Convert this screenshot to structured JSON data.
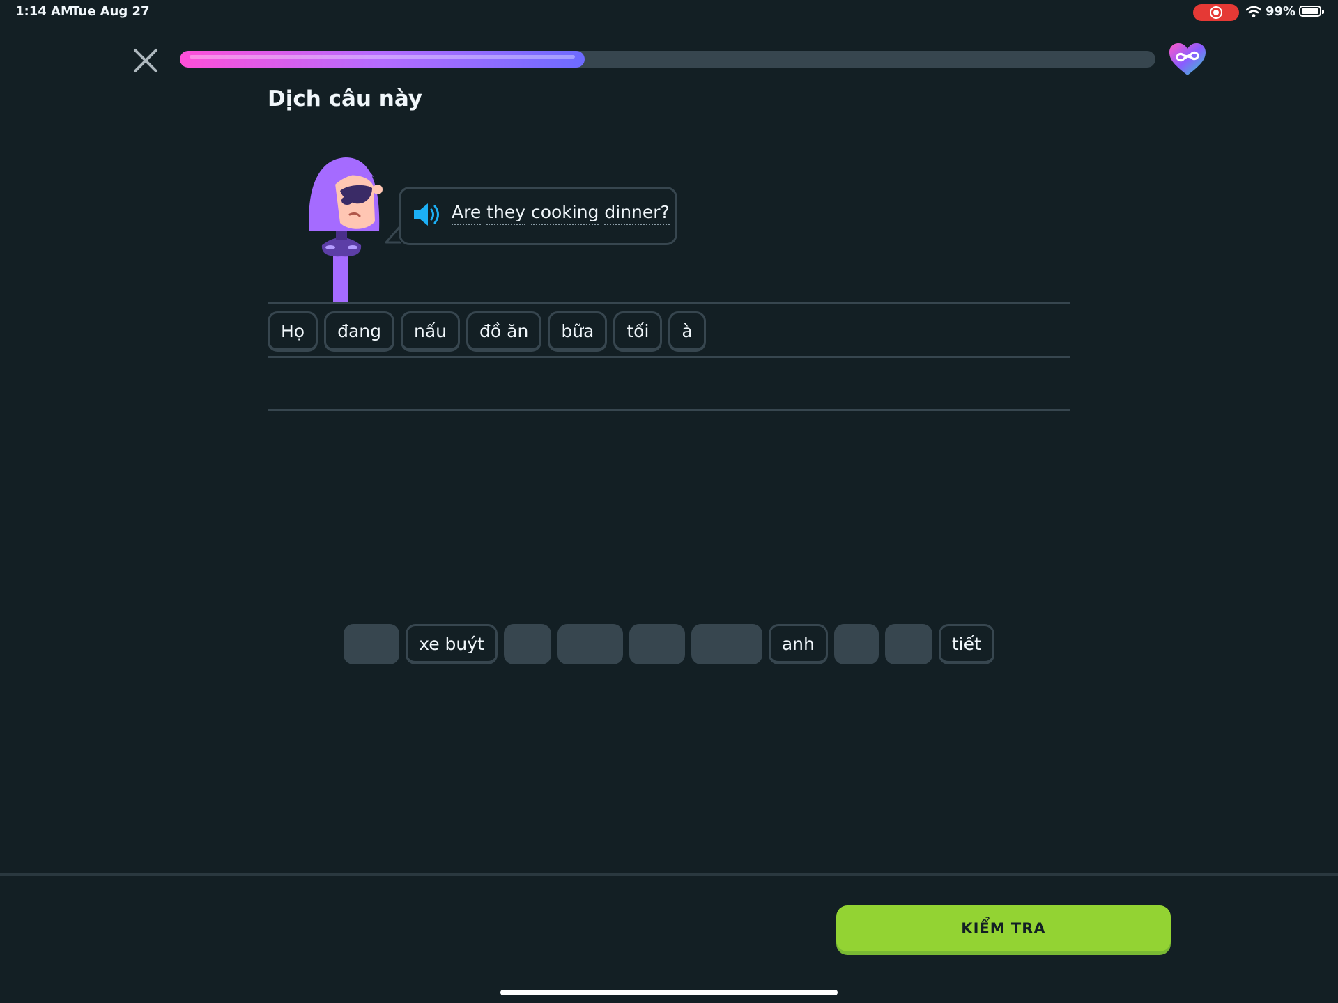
{
  "status_bar": {
    "time": "1:14 AM",
    "date": "Tue Aug 27",
    "battery": "99%",
    "icons": [
      "screen-record-icon",
      "wifi-icon",
      "battery-icon"
    ]
  },
  "header": {
    "close_icon": "close-icon",
    "progress": 0.415,
    "hearts_icon": "infinity-heart-icon"
  },
  "title": "Dịch câu này",
  "prompt": {
    "speaker_icon": "speaker-icon",
    "words": [
      "Are",
      "they",
      "cooking",
      "dinner?"
    ]
  },
  "answer": {
    "chips": [
      "Họ",
      "đang",
      "nấu",
      "đồ ăn",
      "bữa",
      "tối",
      "à"
    ]
  },
  "word_bank": [
    {
      "label": "",
      "used": true,
      "width": 80
    },
    {
      "label": "xe buýt",
      "used": false
    },
    {
      "label": "",
      "used": true,
      "width": 68
    },
    {
      "label": "",
      "used": true,
      "width": 94
    },
    {
      "label": "",
      "used": true,
      "width": 80
    },
    {
      "label": "",
      "used": true,
      "width": 102
    },
    {
      "label": "anh",
      "used": false
    },
    {
      "label": "",
      "used": true,
      "width": 64
    },
    {
      "label": "",
      "used": true,
      "width": 68
    },
    {
      "label": "tiết",
      "used": false
    }
  ],
  "footer": {
    "check_label": "KIỂM TRA"
  },
  "colors": {
    "background": "#131f24",
    "border": "#37464f",
    "accent_green": "#93d333",
    "progress_start": "#ff4fd8",
    "progress_end": "#6d6bff",
    "speaker_blue": "#1cb0f6"
  }
}
